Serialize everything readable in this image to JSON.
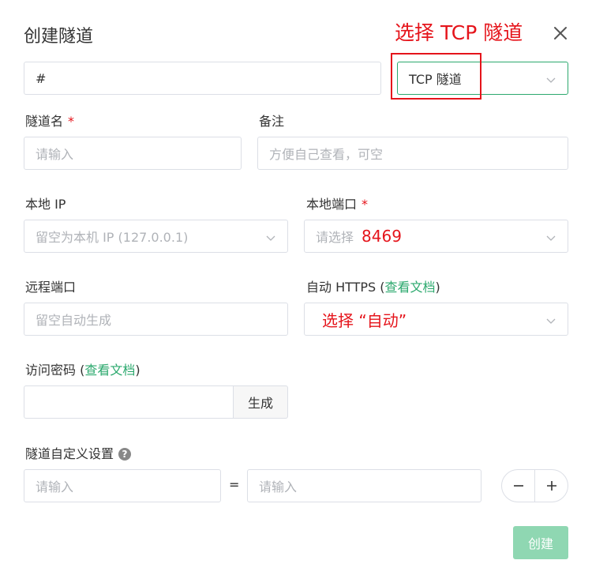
{
  "dialog": {
    "title": "创建隧道"
  },
  "annotations": {
    "top": "选择 TCP 隧道",
    "local_port": "8469",
    "https": "选择 “自动”"
  },
  "fields": {
    "node_input_value": "#",
    "tunnel_type_value": "TCP 隧道",
    "tunnel_name_label": "隧道名",
    "required_mark": "*",
    "tunnel_name_placeholder": "请输入",
    "remark_label": "备注",
    "remark_placeholder": "方便自己查看，可空",
    "local_ip_label": "本地 IP",
    "local_ip_placeholder": "留空为本机 IP (127.0.0.1)",
    "local_port_label": "本地端口",
    "local_port_placeholder": "请选择",
    "remote_port_label": "远程端口",
    "remote_port_placeholder": "留空自动生成",
    "https_label": "自动 HTTPS (",
    "https_doc_link": "查看文档",
    "https_label_close": ")",
    "password_label": "访问密码 (",
    "password_doc_link": "查看文档",
    "password_label_close": ")",
    "generate_label": "生成",
    "custom_label": "隧道自定义设置",
    "custom_key_placeholder": "请输入",
    "equals": "=",
    "custom_value_placeholder": "请输入"
  },
  "actions": {
    "create_label": "创建"
  },
  "icons": {
    "close": "close-icon",
    "chevron": "chevron-down-icon",
    "help": "question-icon",
    "minus": "minus-icon",
    "plus": "plus-icon"
  },
  "colors": {
    "accent": "#2ca96e",
    "annotation": "#e5141b",
    "create_button": "#8fd7b2"
  }
}
